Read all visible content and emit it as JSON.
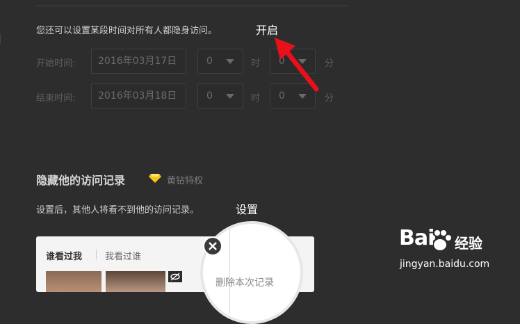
{
  "hidden_visit": {
    "description": "您还可以设置某段时间对所有人都隐身访问。",
    "enable_label": "开启",
    "start": {
      "label": "开始时间:",
      "date": "2016年03月17日",
      "hour": "0",
      "hour_unit": "时",
      "minute": "0",
      "minute_unit": "分"
    },
    "end": {
      "label": "结束时间:",
      "date": "2016年03月18日",
      "hour": "0",
      "hour_unit": "时",
      "minute": "0",
      "minute_unit": "分"
    }
  },
  "hide_records": {
    "title": "隐藏他的访问记录",
    "badge_label": "黄钻特权",
    "badge_color": "#f5c518",
    "description": "设置后，其他人将看不到他的访问记录。",
    "setting_label": "设置"
  },
  "preview_card": {
    "tab_visitors": "谁看过我",
    "tab_visited": "我看过谁",
    "magnified_action": "删除本次记录",
    "icons": [
      "close-icon",
      "eye-hidden-icon"
    ]
  },
  "annotation": {
    "arrow_color": "#e8101a"
  },
  "watermark": {
    "logo_text": "Bai",
    "logo_cn": "经验",
    "url": "jingyan.baidu.com"
  }
}
